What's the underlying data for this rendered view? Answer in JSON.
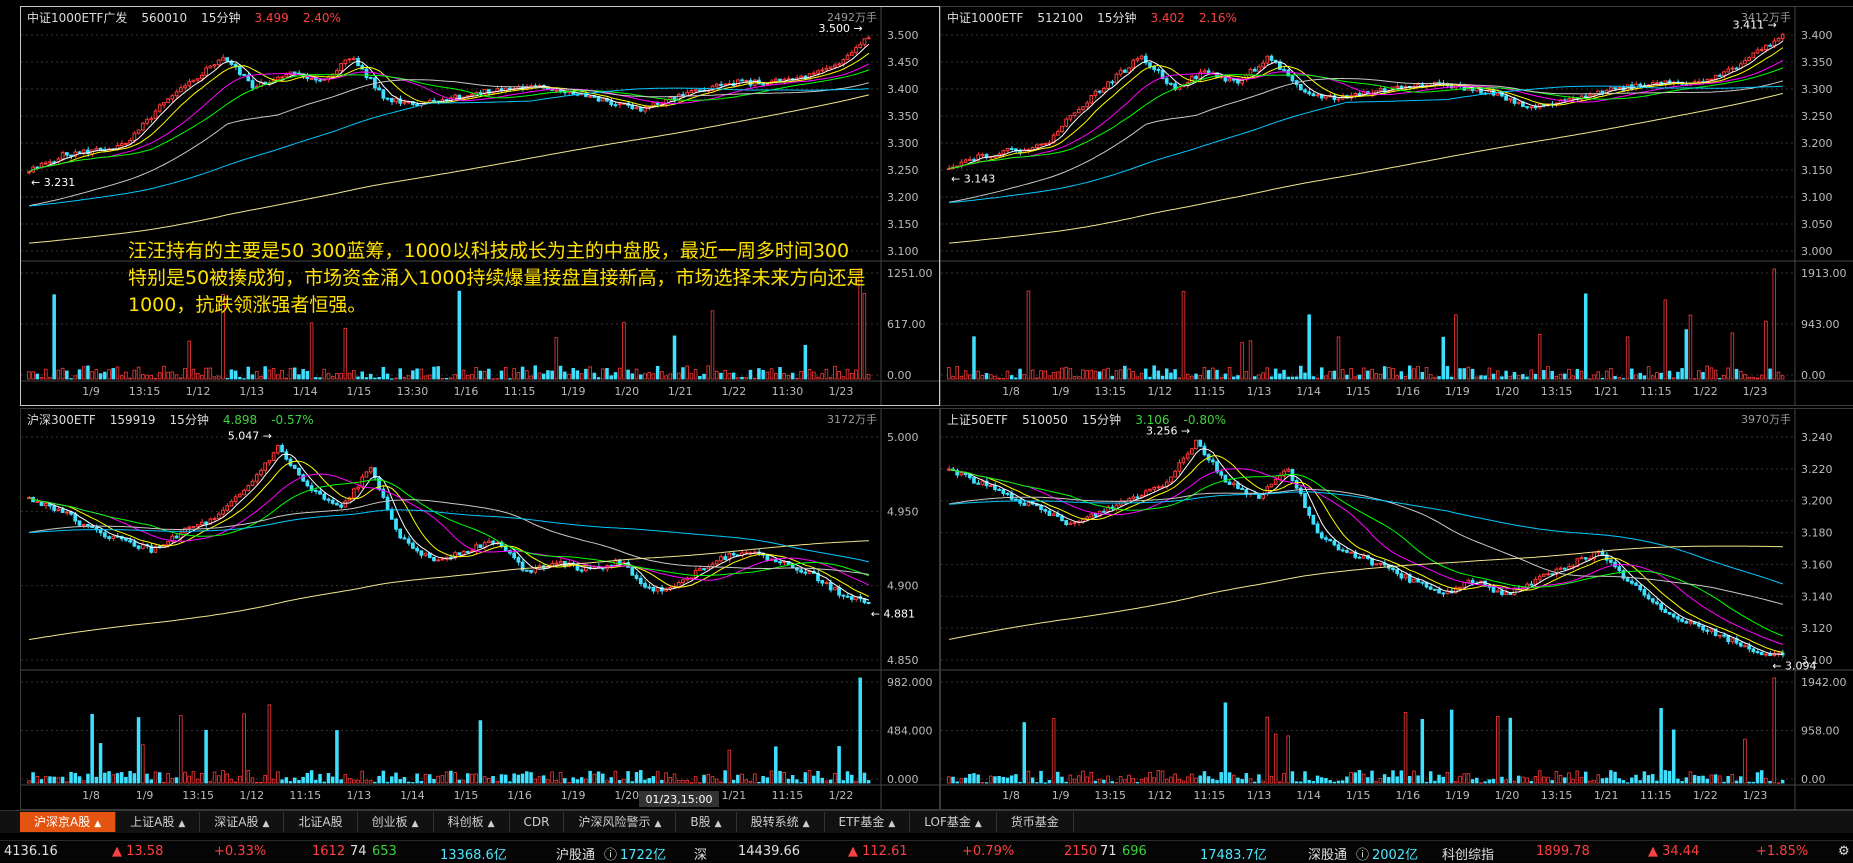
{
  "panels": [
    {
      "name": "中证1000ETF广发",
      "code": "560010",
      "period": "15分钟",
      "price": "3.499",
      "pct": "2.40%",
      "pct_dir": "up",
      "vol_unit": "2492万手",
      "hi_label": "3.500",
      "lo_label": "3.231",
      "price_ticks": [
        "3.500",
        "3.450",
        "3.400",
        "3.350",
        "3.300",
        "3.250",
        "3.200",
        "3.150",
        "3.100"
      ],
      "vol_ticks": [
        "1251.00",
        "617.00",
        "0.00"
      ],
      "x_labels": [
        "1/9",
        "13:15",
        "1/12",
        "1/13",
        "1/14",
        "1/15",
        "13:30",
        "1/16",
        "11:15",
        "1/19",
        "1/20",
        "1/21",
        "1/22",
        "11:30",
        "1/23"
      ]
    },
    {
      "name": "中证1000ETF",
      "code": "512100",
      "period": "15分钟",
      "price": "3.402",
      "pct": "2.16%",
      "pct_dir": "up",
      "vol_unit": "3412万手",
      "hi_label": "3.411",
      "lo_label": "3.143",
      "price_ticks": [
        "3.400",
        "3.350",
        "3.300",
        "3.250",
        "3.200",
        "3.150",
        "3.100",
        "3.050",
        "3.000"
      ],
      "vol_ticks": [
        "1913.00",
        "943.00",
        "0.00"
      ],
      "x_labels": [
        "1/8",
        "1/9",
        "13:15",
        "1/12",
        "11:15",
        "1/13",
        "1/14",
        "1/15",
        "1/16",
        "1/19",
        "1/20",
        "13:15",
        "1/21",
        "11:15",
        "1/22",
        "1/23"
      ]
    },
    {
      "name": "沪深300ETF",
      "code": "159919",
      "period": "15分钟",
      "price": "4.898",
      "pct": "-0.57%",
      "pct_dir": "dn",
      "vol_unit": "3172万手",
      "hi_label": "5.047",
      "lo_label": "4.881",
      "price_ticks": [
        "5.000",
        "4.950",
        "4.900",
        "4.850"
      ],
      "vol_ticks": [
        "982.000",
        "484.000",
        "0.000"
      ],
      "x_labels": [
        "1/8",
        "1/9",
        "13:15",
        "1/12",
        "11:15",
        "1/13",
        "1/14",
        "1/15",
        "1/16",
        "1/19",
        "1/20",
        "13:15",
        "1/21",
        "11:15",
        "1/22"
      ],
      "cursor_label": "01/23,15:00"
    },
    {
      "name": "上证50ETF",
      "code": "510050",
      "period": "15分钟",
      "price": "3.106",
      "pct": "-0.80%",
      "pct_dir": "dn",
      "vol_unit": "3970万手",
      "hi_label": "3.256",
      "lo_label": "3.094",
      "price_ticks": [
        "3.240",
        "3.220",
        "3.200",
        "3.180",
        "3.160",
        "3.140",
        "3.120",
        "3.100"
      ],
      "vol_ticks": [
        "1942.00",
        "958.00",
        "0.00"
      ],
      "x_labels": [
        "1/8",
        "1/9",
        "13:15",
        "1/12",
        "11:15",
        "1/13",
        "1/14",
        "1/15",
        "1/16",
        "1/19",
        "1/20",
        "13:15",
        "1/21",
        "11:15",
        "1/22",
        "1/23"
      ]
    }
  ],
  "annotation": "汪汪持有的主要是50 300蓝筹，1000以科技成长为主的中盘股，最近一周多时间300 特别是50被揍成狗，市场资金涌入1000持续爆量接盘直接新高，市场选择未来方向还是1000，抗跌领涨强者恒强。",
  "tabs": [
    {
      "label": "沪深京A股",
      "arrow": true,
      "active": true
    },
    {
      "label": "上证A股",
      "arrow": true
    },
    {
      "label": "深证A股",
      "arrow": true
    },
    {
      "label": "北证A股",
      "arrow": false
    },
    {
      "label": "创业板",
      "arrow": true
    },
    {
      "label": "科创板",
      "arrow": true
    },
    {
      "label": "CDR",
      "arrow": false
    },
    {
      "label": "沪深风险警示",
      "arrow": true
    },
    {
      "label": "B股",
      "arrow": true
    },
    {
      "label": "股转系统",
      "arrow": true
    },
    {
      "label": "ETF基金",
      "arrow": true
    },
    {
      "label": "LOF基金",
      "arrow": true
    },
    {
      "label": "货币基金",
      "arrow": false
    }
  ],
  "status": {
    "sh_index": "4136.16",
    "sh_chg": "▲ 13.58",
    "sh_pct": "+0.33%",
    "sh_up": "1612",
    "sh_flat": "74",
    "sh_down": "653",
    "sh_amount": "13368.6亿",
    "hgt_label": "沪股通",
    "hgt_value": "1722亿",
    "sz_label": "深",
    "sz_index": "14439.66",
    "sz_chg": "▲ 112.61",
    "sz_pct": "+0.79%",
    "sz_up": "2150",
    "sz_flat": "71",
    "sz_down": "696",
    "sz_amount": "17483.7亿",
    "sgt_label": "深股通",
    "sgt_value": "2002亿",
    "kc_label": "科创综指",
    "kc_index": "1899.78",
    "kc_chg": "▲ 34.44",
    "kc_pct": "+1.85%"
  },
  "chart_data": [
    {
      "type": "candlestick",
      "title": "中证1000ETF广发 560010 15分钟",
      "y_range": [
        3.08,
        3.52
      ],
      "hi": 3.5,
      "lo": 3.231,
      "close_path": [
        3.24,
        3.27,
        3.28,
        3.29,
        3.36,
        3.41,
        3.46,
        3.4,
        3.43,
        3.41,
        3.46,
        3.38,
        3.37,
        3.38,
        3.39,
        3.4,
        3.4,
        3.39,
        3.37,
        3.36,
        3.38,
        3.4,
        3.41,
        3.41,
        3.42,
        3.44,
        3.5
      ],
      "vol_range": [
        0,
        1251
      ]
    },
    {
      "type": "candlestick",
      "title": "中证1000ETF 512100 15分钟",
      "y_range": [
        2.98,
        3.42
      ],
      "hi": 3.411,
      "lo": 3.143,
      "close_path": [
        3.15,
        3.17,
        3.18,
        3.19,
        3.26,
        3.31,
        3.36,
        3.3,
        3.33,
        3.31,
        3.36,
        3.29,
        3.28,
        3.29,
        3.3,
        3.31,
        3.3,
        3.29,
        3.26,
        3.27,
        3.29,
        3.3,
        3.31,
        3.31,
        3.32,
        3.36,
        3.4
      ],
      "vol_range": [
        0,
        1913
      ]
    },
    {
      "type": "candlestick",
      "title": "沪深300ETF 159919 15分钟",
      "y_range": [
        4.83,
        5.06
      ],
      "hi": 5.047,
      "lo": 4.881,
      "close_path": [
        4.99,
        4.98,
        4.96,
        4.95,
        4.94,
        4.96,
        4.97,
        5.0,
        5.04,
        5.0,
        4.98,
        5.02,
        4.95,
        4.93,
        4.94,
        4.95,
        4.92,
        4.93,
        4.92,
        4.93,
        4.9,
        4.91,
        4.93,
        4.94,
        4.93,
        4.92,
        4.9,
        4.89
      ],
      "vol_range": [
        0,
        982
      ]
    },
    {
      "type": "candlestick",
      "title": "上证50ETF 510050 15分钟",
      "y_range": [
        3.09,
        3.26
      ],
      "hi": 3.256,
      "lo": 3.094,
      "close_path": [
        3.23,
        3.22,
        3.21,
        3.2,
        3.19,
        3.2,
        3.21,
        3.22,
        3.25,
        3.22,
        3.21,
        3.23,
        3.18,
        3.17,
        3.16,
        3.15,
        3.14,
        3.15,
        3.14,
        3.15,
        3.16,
        3.17,
        3.15,
        3.13,
        3.12,
        3.11,
        3.1,
        3.095
      ],
      "vol_range": [
        0,
        1942
      ]
    }
  ]
}
